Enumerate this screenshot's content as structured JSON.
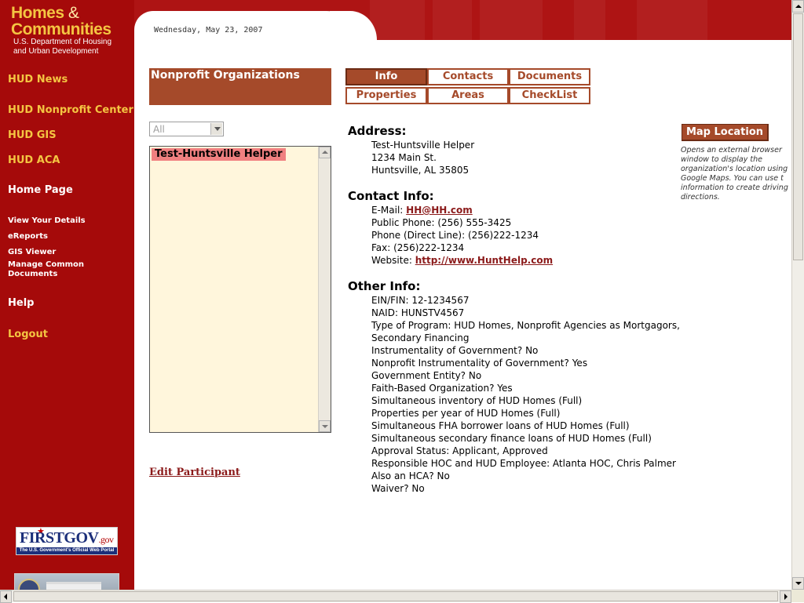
{
  "logo": {
    "line1": "Homes",
    "amp": "&",
    "line2": "Communities",
    "sub1": "U.S. Department of Housing",
    "sub2": "and Urban Development"
  },
  "header": {
    "date": "Wednesday, May 23, 2007"
  },
  "nav": {
    "hud_news": "HUD News",
    "nonprofit_center": "HUD Nonprofit Center",
    "gis": "HUD GIS",
    "aca": "HUD ACA",
    "home_page": "Home Page",
    "view_details": "View Your Details",
    "ereports": "eReports",
    "gis_viewer": "GIS Viewer",
    "manage_docs_1": "Manage Common",
    "manage_docs_2": "Documents",
    "help": "Help",
    "logout": "Logout"
  },
  "footer_logos": {
    "firstgov_main": "FIRSTGOV",
    "firstgov_gov": ".gov",
    "firstgov_tag": "The U.S. Government's Official Web Portal"
  },
  "org": {
    "title": "Nonprofit Organizations",
    "filter_value": "All",
    "list": [
      "Test-Huntsville Helper"
    ],
    "edit_link": "Edit Participant"
  },
  "tabs": {
    "info": "Info",
    "contacts": "Contacts",
    "documents": "Documents",
    "properties": "Properties",
    "areas": "Areas",
    "checklist": "CheckList"
  },
  "address": {
    "heading": "Address:",
    "name": "Test-Huntsville Helper",
    "street": "1234 Main St.",
    "city": "Huntsville, AL 35805"
  },
  "contact": {
    "heading": "Contact Info:",
    "email_label": "E-Mail: ",
    "email": "HH@HH.com",
    "public_phone": "Public Phone: (256) 555-3425",
    "direct_phone": "Phone (Direct Line): (256)222-1234",
    "fax": "Fax: (256)222-1234",
    "website_label": "Website: ",
    "website": "http://www.HuntHelp.com"
  },
  "other": {
    "heading": "Other Info:",
    "lines": [
      "EIN/FIN: 12-1234567",
      "NAID: HUNSTV4567",
      "Type of Program: HUD Homes, Nonprofit Agencies as Mortgagors,",
      "Secondary Financing",
      "Instrumentality of Government? No",
      "Nonprofit Instrumentality of Government? Yes",
      "Government Entity? No",
      "Faith-Based Organization? Yes",
      "Simultaneous inventory of HUD Homes (Full)",
      "Properties per year of HUD Homes (Full)",
      "Simultaneous FHA borrower loans of HUD Homes (Full)",
      "Simultaneous secondary finance loans of HUD Homes (Full)",
      "Approval Status: Applicant, Approved",
      "Responsible HOC and HUD Employee: Atlanta HOC, Chris Palmer",
      "Also an HCA? No",
      "Waiver? No"
    ]
  },
  "map": {
    "button": "Map Location",
    "note": [
      "Opens an external browser",
      "window to display the",
      "organization's location using",
      "Google Maps. You can use t",
      "information to create driving",
      "directions."
    ]
  },
  "colors": {
    "sidebar": "#a50a0a",
    "gold": "#f4c542",
    "accent": "#a54a2a",
    "link": "#8b1a1a",
    "list_bg": "#fff6dc",
    "selected": "#f08080"
  }
}
